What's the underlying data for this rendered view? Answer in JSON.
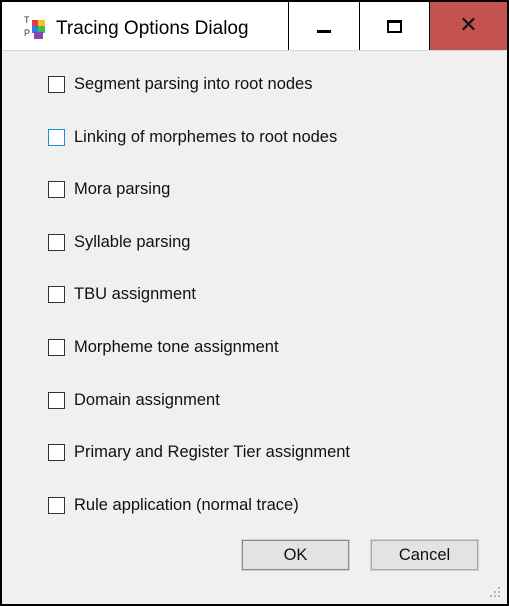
{
  "window": {
    "title": "Tracing Options Dialog",
    "app_icon": "tp-app-icon",
    "controls": {
      "minimize_icon": "minimize-icon",
      "maximize_icon": "maximize-icon",
      "close_glyph": "✕",
      "close_color": "#c4534f"
    }
  },
  "options": [
    {
      "label": "Segment parsing into root nodes",
      "checked": false,
      "focused": false
    },
    {
      "label": "Linking of morphemes to root nodes",
      "checked": false,
      "focused": true
    },
    {
      "label": "Mora parsing",
      "checked": false,
      "focused": false
    },
    {
      "label": "Syllable parsing",
      "checked": false,
      "focused": false
    },
    {
      "label": "TBU assignment",
      "checked": false,
      "focused": false
    },
    {
      "label": "Morpheme tone assignment",
      "checked": false,
      "focused": false
    },
    {
      "label": "Domain assignment",
      "checked": false,
      "focused": false
    },
    {
      "label": "Primary and Register Tier assignment",
      "checked": false,
      "focused": false
    },
    {
      "label": "Rule application (normal trace)",
      "checked": false,
      "focused": false
    }
  ],
  "buttons": {
    "ok_label": "OK",
    "cancel_label": "Cancel"
  },
  "colors": {
    "focus_border": "#1d8fd8",
    "dialog_background": "#f0f0f0"
  }
}
